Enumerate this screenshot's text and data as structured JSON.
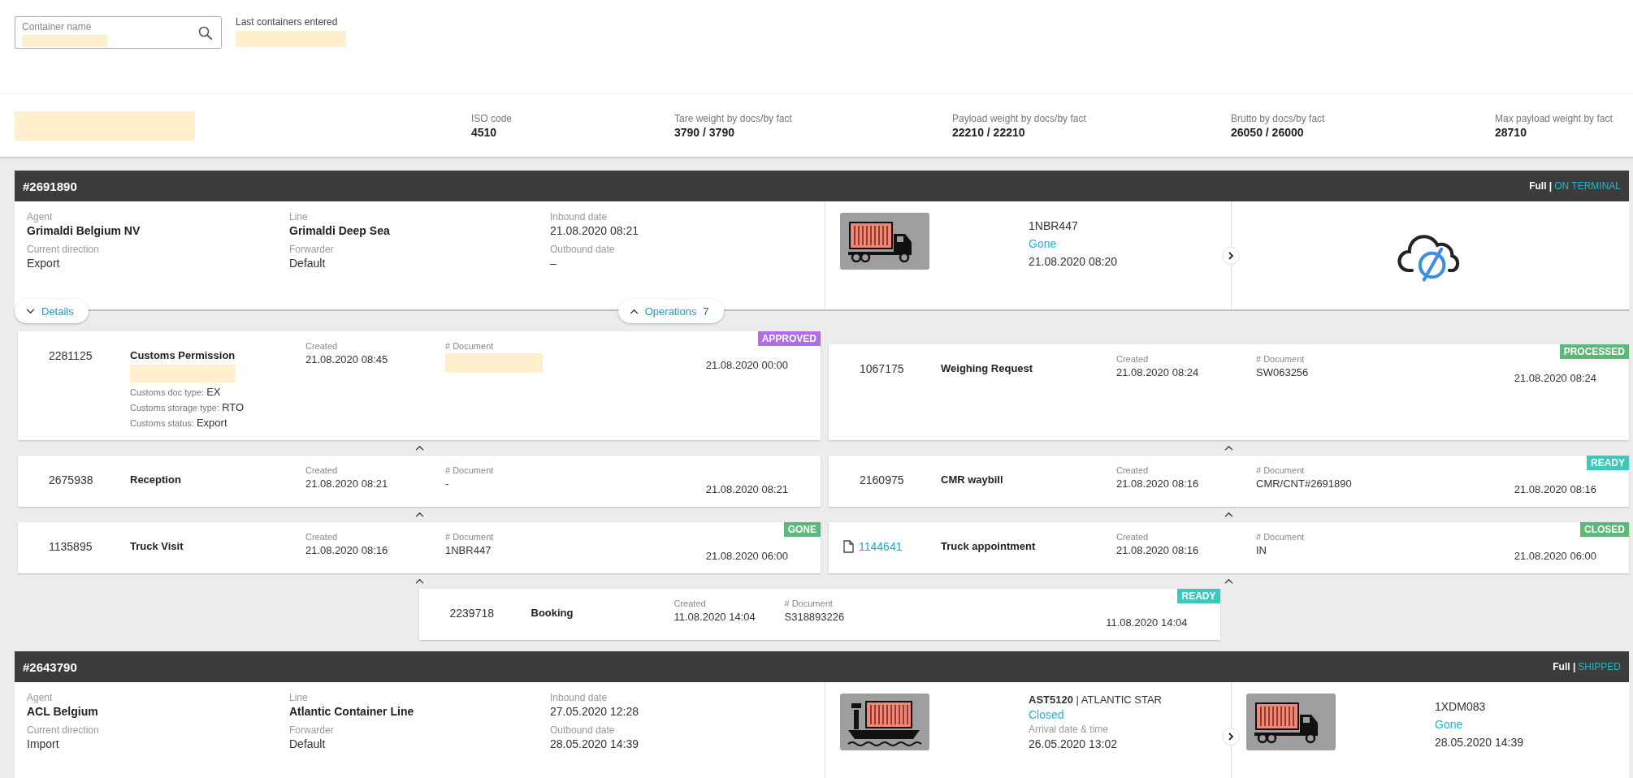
{
  "search": {
    "label": "Container name",
    "redacted": true
  },
  "recent": {
    "label": "Last containers entered",
    "redacted": true
  },
  "summary": {
    "redacted": true,
    "fields": [
      {
        "label": "ISO code",
        "value": "4510"
      },
      {
        "label": "Tare weight by docs/by fact",
        "value": "3790 / 3790"
      },
      {
        "label": "Payload weight by docs/by fact",
        "value": "22210 / 22210"
      },
      {
        "label": "Brutto by docs/by fact",
        "value": "26050 / 26000"
      },
      {
        "label": "Max payload weight by fact",
        "value": "28710"
      }
    ]
  },
  "containers": [
    {
      "number": "#2691890",
      "load": "Full |",
      "status": "ON TERMINAL",
      "details": [
        {
          "label": "Agent",
          "value": "Grimaldi Belgium NV",
          "bold": true
        },
        {
          "label": "Line",
          "value": "Grimaldi Deep Sea",
          "bold": true
        },
        {
          "label": "Inbound date",
          "value": "21.08.2020 08:21",
          "bold": false
        },
        {
          "label": "Current direction",
          "value": "Export",
          "bold": false
        },
        {
          "label": "Forwarder",
          "value": "Default",
          "bold": false
        },
        {
          "label": "Outbound date",
          "value": "–",
          "bold": false
        }
      ],
      "transports": [
        {
          "kind": "truck",
          "plate": "1NBR447",
          "state": "Gone",
          "date": "21.08.2020 08:20"
        },
        {
          "kind": "none"
        }
      ],
      "details_toggle": "Details",
      "operations_toggle": {
        "label": "Operations",
        "count": "7"
      },
      "operations": {
        "rows": [
          {
            "left": {
              "id": "2281125",
              "linked": false,
              "name": "Customs Permission",
              "note_redacted": true,
              "extras": [
                {
                  "label": "Customs doc type:",
                  "value": "EX"
                },
                {
                  "label": "Customs storage type:",
                  "value": "RTO"
                },
                {
                  "label": "Customs status:",
                  "value": "Export"
                }
              ],
              "created_label": "Created",
              "created": "21.08.2020 08:45",
              "doc_label": "# Document",
              "doc_redacted": true,
              "date": "21.08.2020 00:00",
              "status": "APPROVED",
              "color": "#b06ee6"
            },
            "right": {
              "id": "1067175",
              "linked": false,
              "name": "Weighing Request",
              "created_label": "Created",
              "created": "21.08.2020 08:24",
              "doc_label": "# Document",
              "doc": "SW063256",
              "date": "21.08.2020 08:24",
              "status": "PROCESSED",
              "color": "#5cb87a"
            }
          },
          {
            "left": {
              "id": "2675938",
              "linked": false,
              "name": "Reception",
              "created_label": "Created",
              "created": "21.08.2020 08:21",
              "doc_label": "# Document",
              "doc": "-",
              "date": "21.08.2020 08:21"
            },
            "right": {
              "id": "2160975",
              "linked": false,
              "name": "CMR waybill",
              "created_label": "Created",
              "created": "21.08.2020 08:16",
              "doc_label": "# Document",
              "doc": "CMR/CNT#2691890",
              "date": "21.08.2020 08:16",
              "status": "READY",
              "color": "#3ec7bd"
            }
          },
          {
            "left": {
              "id": "1135895",
              "linked": false,
              "name": "Truck Visit",
              "created_label": "Created",
              "created": "21.08.2020 08:16",
              "doc_label": "# Document",
              "doc": "1NBR447",
              "date": "21.08.2020 06:00",
              "status": "GONE",
              "color": "#5cb87a"
            },
            "right": {
              "id": "1144641",
              "linked": true,
              "name": "Truck appointment",
              "created_label": "Created",
              "created": "21.08.2020 08:16",
              "doc_label": "# Document",
              "doc": "IN",
              "date": "21.08.2020 06:00",
              "status": "CLOSED",
              "color": "#5cb87a"
            }
          }
        ],
        "bottom": {
          "id": "2239718",
          "linked": false,
          "name": "Booking",
          "created_label": "Created",
          "created": "11.08.2020 14:04",
          "doc_label": "# Document",
          "doc": "S318893226",
          "date": "11.08.2020 14:04",
          "status": "READY",
          "color": "#3ec7bd"
        }
      }
    },
    {
      "number": "#2643790",
      "load": "Full |",
      "status": "SHIPPED",
      "details": [
        {
          "label": "Agent",
          "value": "ACL Belgium",
          "bold": true
        },
        {
          "label": "Line",
          "value": "Atlantic Container Line",
          "bold": true
        },
        {
          "label": "Inbound date",
          "value": "27.05.2020 12:28",
          "bold": false
        },
        {
          "label": "Current direction",
          "value": "Import",
          "bold": false
        },
        {
          "label": "Forwarder",
          "value": "Default",
          "bold": false
        },
        {
          "label": "Outbound date",
          "value": "28.05.2020 14:39",
          "bold": false
        }
      ],
      "transports": [
        {
          "kind": "ship",
          "title": "**AST5120** | ATLANTIC STAR",
          "state": "Closed",
          "date_label": "Arrival date & time",
          "date": "26.05.2020 13:02"
        },
        {
          "kind": "truck",
          "plate": "1XDM083",
          "state": "Gone",
          "date": "28.05.2020 14:39"
        }
      ]
    }
  ]
}
